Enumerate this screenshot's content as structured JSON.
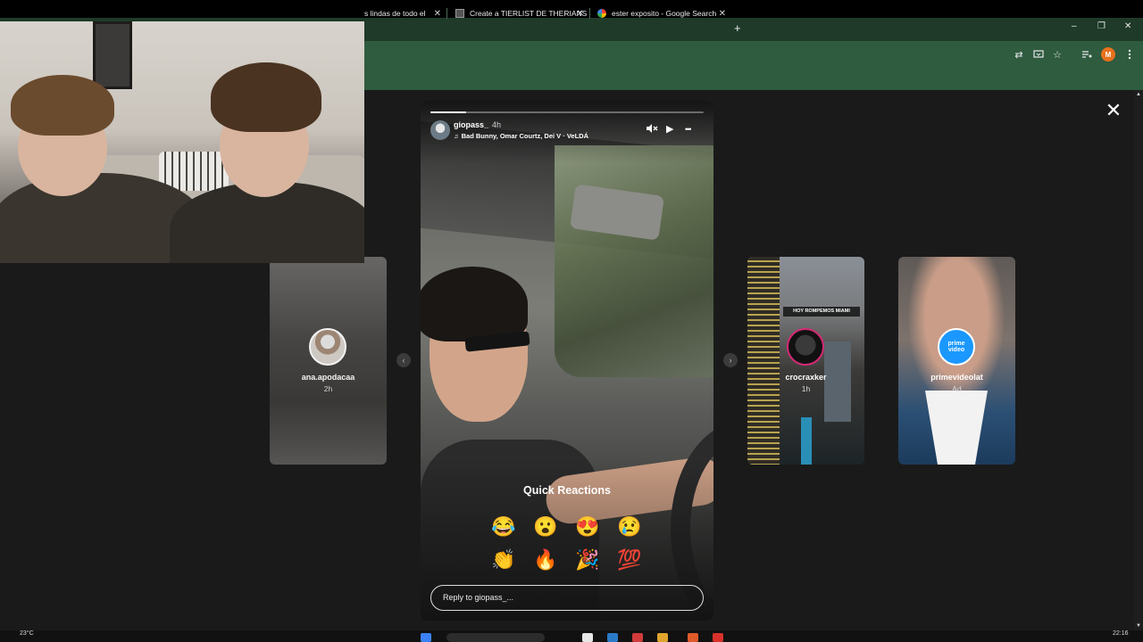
{
  "browser": {
    "tabs": [
      {
        "title": "s lindas de todo el",
        "close": "✕"
      },
      {
        "title": "Create a TIERLIST DE THERIANS",
        "close": "✕"
      },
      {
        "title": "ester exposito - Google Search",
        "close": "✕"
      }
    ],
    "new_tab": "+",
    "window_controls": {
      "minimize": "–",
      "restore": "❐",
      "close": "✕"
    },
    "profile_initial": "M"
  },
  "story": {
    "username": "giopass_",
    "time": "4h",
    "music": "Bad Bunny, Omar Courtz, Dei V · VeLDÁ",
    "progress": 0.13,
    "quick_reactions_title": "Quick Reactions",
    "reactions_row1": [
      "😂",
      "😮",
      "😍",
      "😢"
    ],
    "reactions_row2": [
      "👏",
      "🔥",
      "🎉",
      "💯"
    ],
    "reply_placeholder": "Reply to giopass_..."
  },
  "side_stories": [
    {
      "name": "ana.apodacaa",
      "sub": "2h"
    },
    {
      "name": "crocraxker",
      "sub": "1h",
      "banner": "HOY ROMPEMOS MIAMI"
    },
    {
      "name": "primevideolat",
      "sub": "Ad",
      "logo_line1": "prime",
      "logo_line2": "video"
    }
  ],
  "taskbar": {
    "weather": "23°C",
    "clock": "22:16"
  },
  "icons": {
    "mute": "🔇",
    "play": "▶",
    "more": "•••",
    "close": "✕",
    "prev": "‹",
    "next": "›",
    "translate": "⇄",
    "star": "☆"
  }
}
